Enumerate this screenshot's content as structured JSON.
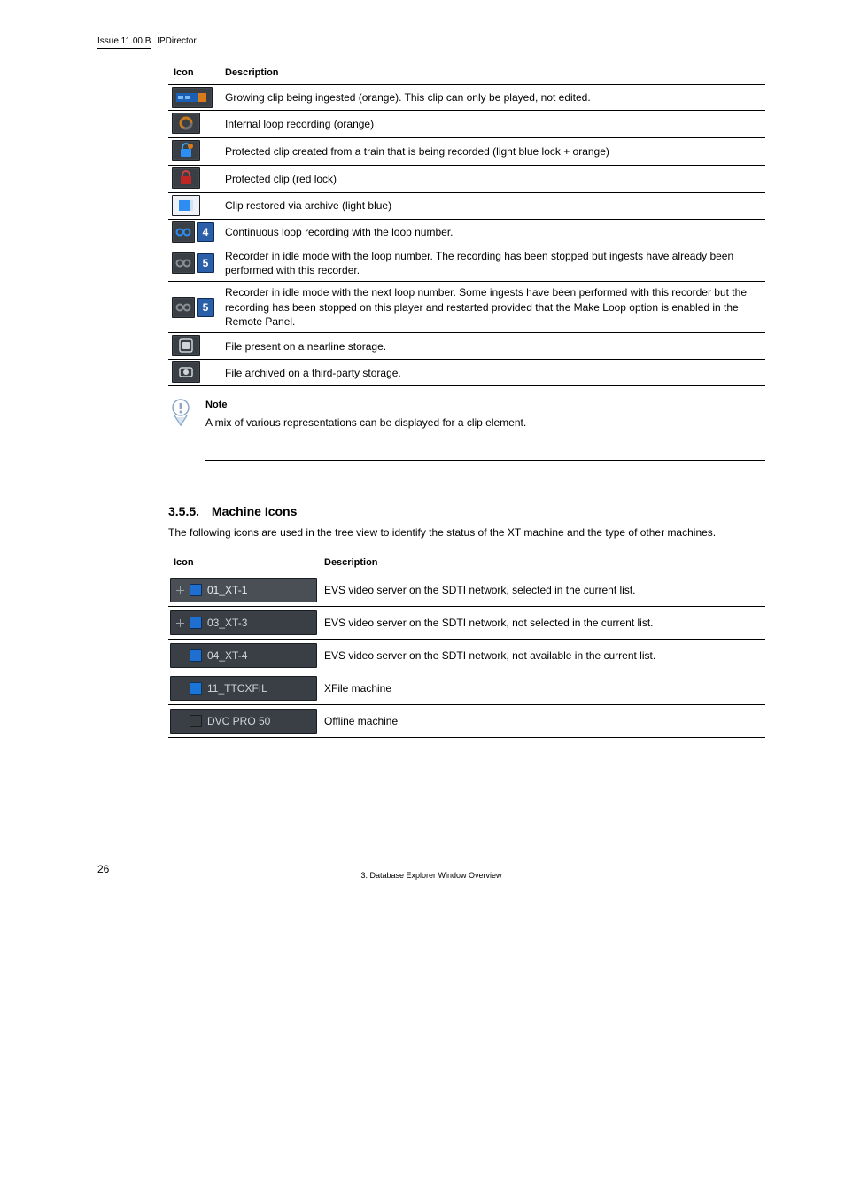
{
  "running_head": {
    "issue": "Issue 11.00.B",
    "product": "IPDirector"
  },
  "table1": {
    "headers": {
      "icon": "Icon",
      "desc": "Description"
    },
    "rows": [
      {
        "desc": "Growing clip being ingested (orange). This clip can only be played, not edited."
      },
      {
        "desc": "Internal loop recording (orange)"
      },
      {
        "desc": "Protected clip created from a train that is being recorded (light blue lock + orange)"
      },
      {
        "desc": "Protected clip (red lock)"
      },
      {
        "desc": "Clip restored via archive (light blue)"
      },
      {
        "desc": "Continuous loop recording with the loop number."
      },
      {
        "desc": "Recorder in idle mode with the loop number. The recording has been stopped but ingests have already been performed with this recorder."
      },
      {
        "desc": "Recorder in idle mode with the next loop number. Some ingests have been performed with this recorder but the recording has been stopped on this player and restarted provided that the Make Loop option is enabled in the Remote Panel."
      },
      {
        "desc": "File present on a nearline storage."
      },
      {
        "desc": "File archived on a third-party storage."
      }
    ]
  },
  "note": {
    "heading": "Note",
    "text": "A mix of various representations can be displayed for a clip element."
  },
  "section": {
    "number": "3.5.5.",
    "title": "Machine Icons",
    "intro": "The following icons are used in the tree view to identify the status of the XT machine and the type of other machines."
  },
  "table2": {
    "headers": {
      "icon": "Icon",
      "desc": "Description"
    },
    "rows": [
      {
        "label": "01_XT-1",
        "kind": "evs-sel-plus",
        "desc": "EVS video server on the SDTI network, selected in the current list."
      },
      {
        "label": "03_XT-3",
        "kind": "evs-plus",
        "desc": "EVS video server on the SDTI network, not selected in the current list."
      },
      {
        "label": "04_XT-4",
        "kind": "evs",
        "desc": "EVS video server on the SDTI network, not available in the current list."
      },
      {
        "label": "11_TTCXFIL",
        "kind": "xfile",
        "desc": "XFile machine"
      },
      {
        "label": "DVC PRO 50",
        "kind": "offline",
        "desc": "Offline machine"
      }
    ]
  },
  "footer": {
    "page": "26",
    "section": "3. Database Explorer Window Overview"
  }
}
